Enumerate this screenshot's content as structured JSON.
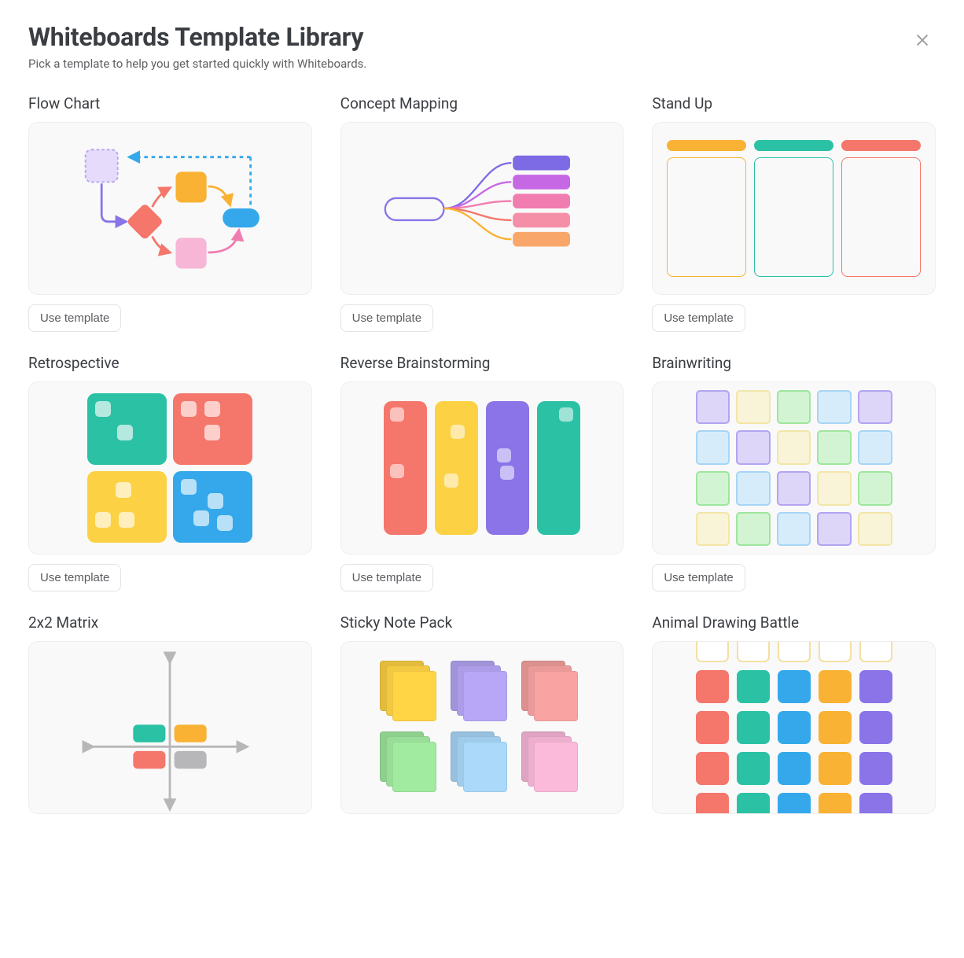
{
  "header": {
    "title": "Whiteboards Template Library",
    "subtitle": "Pick a template to help you get started quickly with Whiteboards."
  },
  "use_template_label": "Use template",
  "templates": [
    {
      "id": "flow-chart",
      "title": "Flow Chart"
    },
    {
      "id": "concept-mapping",
      "title": "Concept Mapping"
    },
    {
      "id": "stand-up",
      "title": "Stand Up"
    },
    {
      "id": "retrospective",
      "title": "Retrospective"
    },
    {
      "id": "reverse-brainstorm",
      "title": "Reverse Brainstorming"
    },
    {
      "id": "brainwriting",
      "title": "Brainwriting"
    },
    {
      "id": "2x2-matrix",
      "title": "2x2 Matrix"
    },
    {
      "id": "sticky-note-pack",
      "title": "Sticky Note Pack"
    },
    {
      "id": "animal-drawing",
      "title": "Animal Drawing Battle"
    }
  ],
  "colors": {
    "orange": "#f9b233",
    "teal": "#2bc1a5",
    "coral": "#f5766b",
    "yellow": "#fcd144",
    "blue": "#34a8eb",
    "purple": "#8a74e8",
    "pink": "#f17cb0",
    "lavender": "#b4a4f2",
    "magenta": "#c668e4",
    "green": "#9ee69e",
    "paleyellow": "#f2e6a8",
    "paleblue": "#a7d5f5",
    "violet": "#7d6be5",
    "gray": "#b7b7b9"
  }
}
